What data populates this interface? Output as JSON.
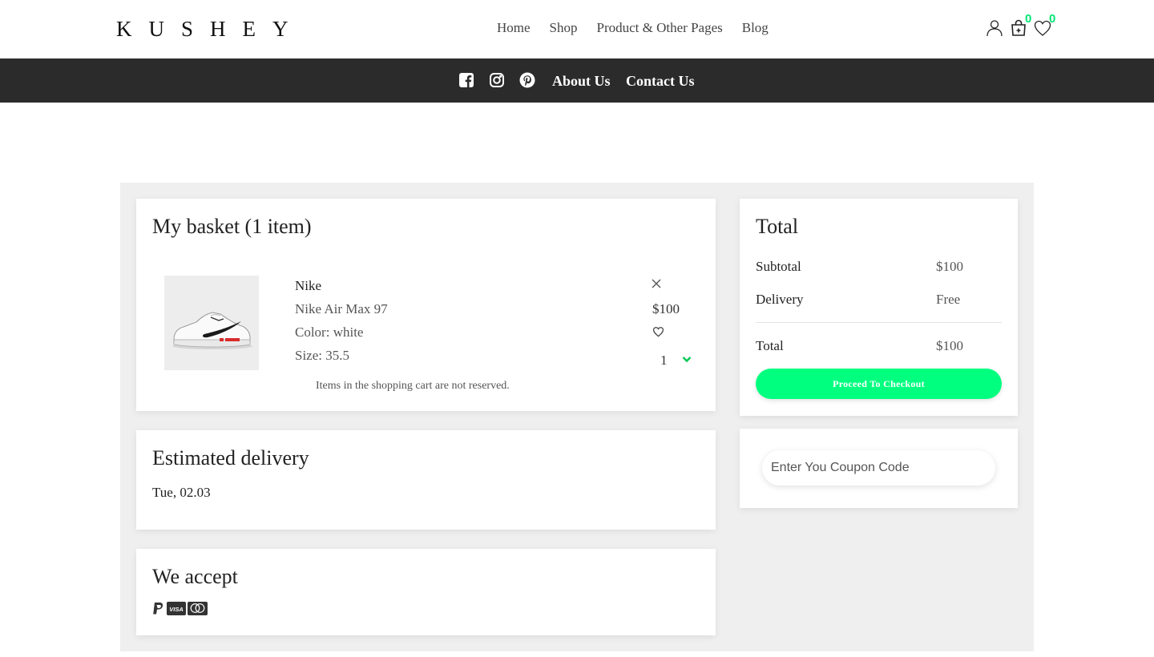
{
  "header": {
    "logo": "KUSHEY",
    "nav": [
      "Home",
      "Shop",
      "Product & Other Pages",
      "Blog"
    ],
    "icons": [
      "user-icon",
      "cart-icon",
      "heart-icon"
    ],
    "cart_count": "0",
    "wishlist_count": "0",
    "accent_color": "#00e676"
  },
  "secondary_nav": {
    "social_icons": [
      "facebook-icon",
      "instagram-icon",
      "pinterest-icon"
    ],
    "links": [
      "About Us",
      "Contact Us"
    ],
    "background": "#2b2b2b"
  },
  "basket": {
    "title": "My basket (1 item)",
    "item": {
      "brand": "Nike",
      "name": "Nike Air Max 97",
      "color": "Color: white",
      "size": "Size: 35.5",
      "price": "$100",
      "quantity": "1",
      "image_icon": "sneaker-image"
    },
    "note": "Items in the shopping cart are not reserved."
  },
  "delivery": {
    "title": "Estimated delivery",
    "date": "Tue, 02.03"
  },
  "payment": {
    "title": "We accept",
    "methods": [
      "paypal-icon",
      "visa-icon",
      "mastercard-icon"
    ]
  },
  "summary": {
    "title": "Total",
    "subtotal_label": "Subtotal",
    "subtotal_value": "$100",
    "delivery_label": "Delivery",
    "delivery_value": "Free",
    "total_label": "Total",
    "total_value": "$100",
    "checkout_label": "Proceed To Checkout",
    "button_color": "#00ff7f"
  },
  "coupon": {
    "placeholder": "Enter You Coupon Code"
  }
}
